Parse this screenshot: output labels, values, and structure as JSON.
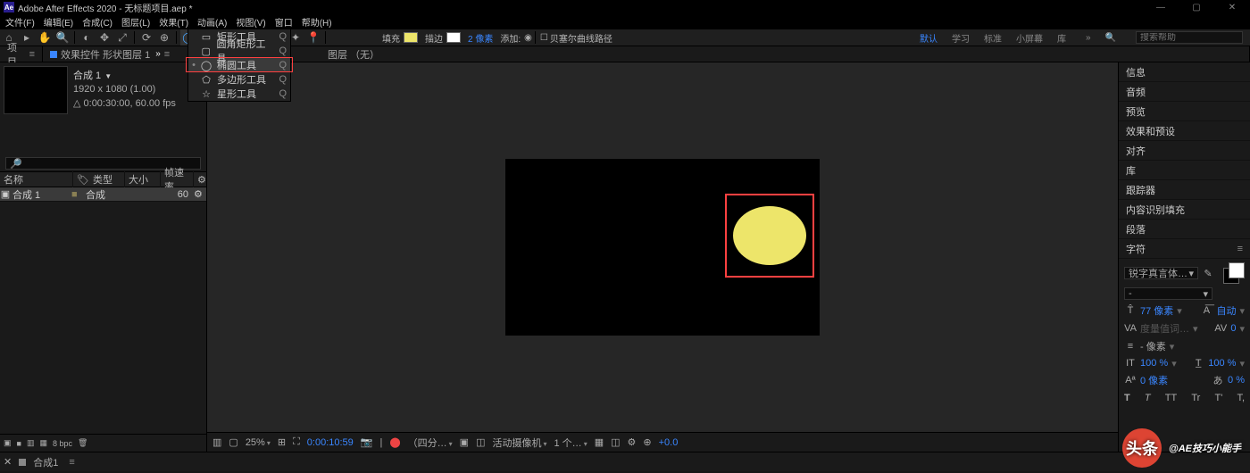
{
  "title": "Adobe After Effects 2020 - 无标题项目.aep *",
  "menus": [
    "文件(F)",
    "编辑(E)",
    "合成(C)",
    "图层(L)",
    "效果(T)",
    "动画(A)",
    "视图(V)",
    "窗口",
    "帮助(H)"
  ],
  "toolbar": {
    "fill_label": "填充",
    "stroke_label": "描边",
    "px_label": "2 像素",
    "add_label": "添加:",
    "bezier_label": "贝塞尔曲线路径"
  },
  "modes": {
    "default": "默认",
    "learn": "学习",
    "standard": "标准",
    "small": "小屏幕",
    "lib": "库"
  },
  "search_ph": "搜索帮助",
  "panel_tabs": {
    "project": "项目",
    "fx": "效果控件 形状图层 1"
  },
  "shape_menu": {
    "rect": "矩形工具",
    "rrect": "圆角矩形工具",
    "ellipse": "椭圆工具",
    "poly": "多边形工具",
    "star": "星形工具",
    "shortcut": "Q"
  },
  "viewer": {
    "layer_none": "图层 （无）"
  },
  "project": {
    "name": "合成 1",
    "res": "1920 x 1080 (1.00)",
    "dur": "△ 0:00:30:00, 60.00 fps",
    "cols": {
      "name": "名称",
      "type": "类型",
      "size": "大小",
      "fps": "帧速率"
    },
    "row": {
      "name": "合成 1",
      "type": "合成",
      "fps": "60"
    },
    "bpc": "8 bpc"
  },
  "viewer_foot": {
    "zoom": "25%",
    "time": "0:00:10:59",
    "quality": "（四分…",
    "cam": "活动摄像机",
    "views": "1 个…",
    "exposure": "+0.0"
  },
  "right_panels": [
    "信息",
    "音频",
    "预览",
    "效果和预设",
    "对齐",
    "库",
    "跟踪器",
    "内容识别填充",
    "段落"
  ],
  "char": {
    "title": "字符",
    "font": "锐字真言体…",
    "weight": "-",
    "size": "77 像素",
    "leading": "自动",
    "tracking_lbl": "度量值词…",
    "tracking": "0",
    "ln": "- 像素",
    "scaleH": "100 %",
    "scaleV": "100 %",
    "baseline": "0 像素",
    "tsume": "0 %",
    "styles": [
      "T",
      "T",
      "TT",
      "Tr",
      "T'",
      "T,"
    ]
  },
  "timeline": {
    "comp": "合成1"
  },
  "wm": {
    "brand": "头条",
    "text": "@AE技巧小能手"
  }
}
